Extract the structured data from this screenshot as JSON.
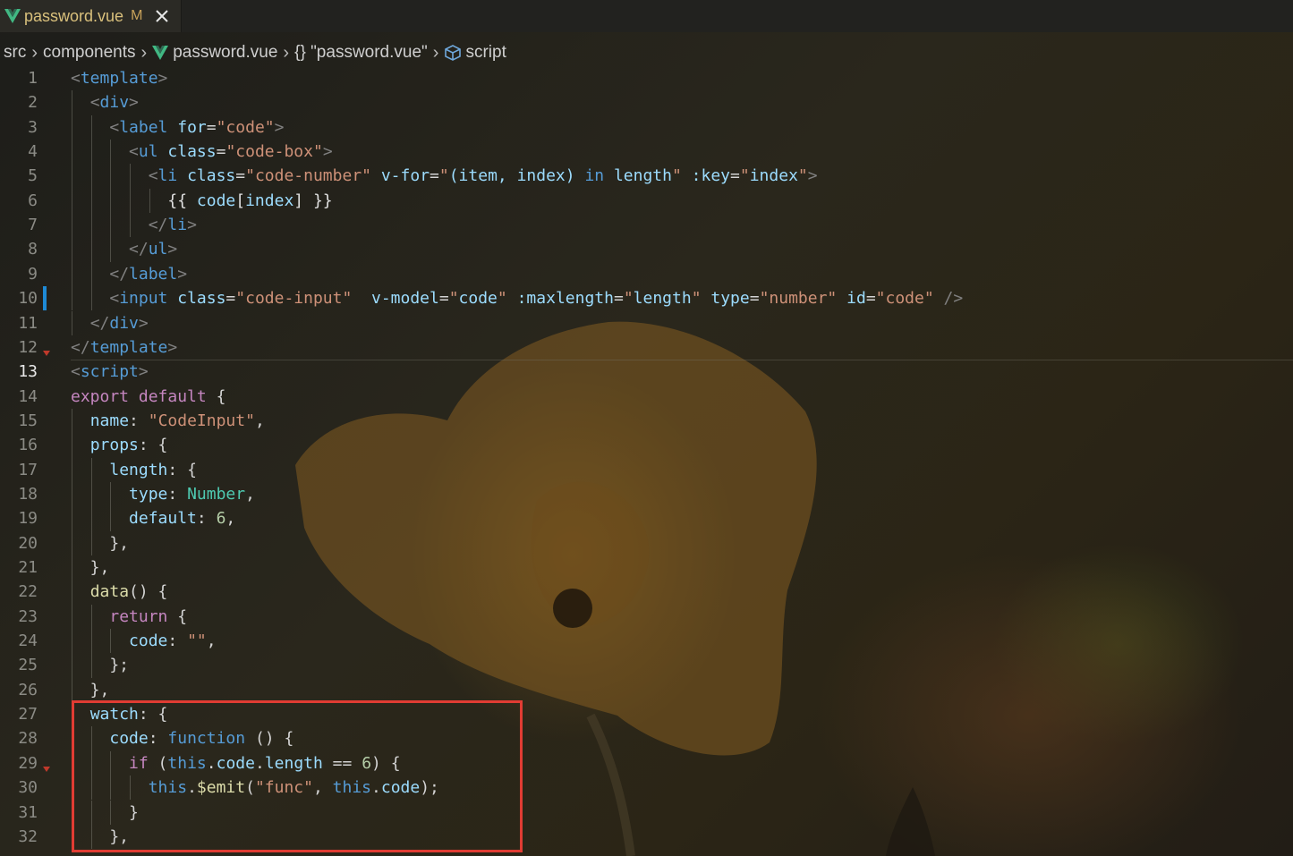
{
  "tab": {
    "label": "password.vue",
    "modified_marker": "M",
    "close_icon": "close-icon"
  },
  "breadcrumb": {
    "items": [
      "src",
      "components",
      "password.vue",
      "{} \"password.vue\"",
      "script"
    ],
    "icons": [
      "",
      "",
      "vue-file-icon",
      "",
      "cube-icon"
    ]
  },
  "colors": {
    "tag": "#569cd6",
    "attribute": "#9cdcfe",
    "string": "#ce9178",
    "keyword": "#c586c0",
    "type": "#4ec9b0",
    "number": "#b5cea8",
    "highlight_box": "#e03c33",
    "vue_icon": "#41b883"
  },
  "editor": {
    "active_line": 13,
    "lines": [
      {
        "n": "1",
        "tokens": [
          [
            "punc",
            "<"
          ],
          [
            "tag",
            "template"
          ],
          [
            "punc",
            ">"
          ]
        ]
      },
      {
        "n": "2",
        "tokens": [
          [
            "plain",
            "  "
          ],
          [
            "punc",
            "<"
          ],
          [
            "tag",
            "div"
          ],
          [
            "punc",
            ">"
          ]
        ]
      },
      {
        "n": "3",
        "tokens": [
          [
            "plain",
            "    "
          ],
          [
            "punc",
            "<"
          ],
          [
            "tag",
            "label"
          ],
          [
            "plain",
            " "
          ],
          [
            "attr",
            "for"
          ],
          [
            "plain",
            "="
          ],
          [
            "str",
            "\"code\""
          ],
          [
            "punc",
            ">"
          ]
        ]
      },
      {
        "n": "4",
        "tokens": [
          [
            "plain",
            "      "
          ],
          [
            "punc",
            "<"
          ],
          [
            "tag",
            "ul"
          ],
          [
            "plain",
            " "
          ],
          [
            "attr",
            "class"
          ],
          [
            "plain",
            "="
          ],
          [
            "str",
            "\"code-box\""
          ],
          [
            "punc",
            ">"
          ]
        ]
      },
      {
        "n": "5",
        "tokens": [
          [
            "plain",
            "        "
          ],
          [
            "punc",
            "<"
          ],
          [
            "tag",
            "li"
          ],
          [
            "plain",
            " "
          ],
          [
            "attr",
            "class"
          ],
          [
            "plain",
            "="
          ],
          [
            "str",
            "\"code-number\""
          ],
          [
            "plain",
            " "
          ],
          [
            "attr",
            "v-for"
          ],
          [
            "plain",
            "="
          ],
          [
            "str",
            "\""
          ],
          [
            "attr",
            "(item, index) "
          ],
          [
            "blue",
            "in"
          ],
          [
            "attr",
            " length"
          ],
          [
            "str",
            "\""
          ],
          [
            "plain",
            " "
          ],
          [
            "attr",
            ":key"
          ],
          [
            "plain",
            "="
          ],
          [
            "str",
            "\""
          ],
          [
            "attr",
            "index"
          ],
          [
            "str",
            "\""
          ],
          [
            "punc",
            ">"
          ]
        ]
      },
      {
        "n": "6",
        "tokens": [
          [
            "plain",
            "          "
          ],
          [
            "white",
            "{{ "
          ],
          [
            "prop",
            "code"
          ],
          [
            "white",
            "["
          ],
          [
            "prop",
            "index"
          ],
          [
            "white",
            "] }}"
          ]
        ]
      },
      {
        "n": "7",
        "tokens": [
          [
            "plain",
            "        "
          ],
          [
            "punc",
            "</"
          ],
          [
            "tag",
            "li"
          ],
          [
            "punc",
            ">"
          ]
        ]
      },
      {
        "n": "8",
        "tokens": [
          [
            "plain",
            "      "
          ],
          [
            "punc",
            "</"
          ],
          [
            "tag",
            "ul"
          ],
          [
            "punc",
            ">"
          ]
        ]
      },
      {
        "n": "9",
        "tokens": [
          [
            "plain",
            "    "
          ],
          [
            "punc",
            "</"
          ],
          [
            "tag",
            "label"
          ],
          [
            "punc",
            ">"
          ]
        ]
      },
      {
        "n": "10",
        "tokens": [
          [
            "plain",
            "    "
          ],
          [
            "punc",
            "<"
          ],
          [
            "tag",
            "input"
          ],
          [
            "plain",
            " "
          ],
          [
            "attr",
            "class"
          ],
          [
            "plain",
            "="
          ],
          [
            "str",
            "\"code-input\""
          ],
          [
            "plain",
            "  "
          ],
          [
            "attr",
            "v-model"
          ],
          [
            "plain",
            "="
          ],
          [
            "str",
            "\""
          ],
          [
            "attr",
            "code"
          ],
          [
            "str",
            "\""
          ],
          [
            "plain",
            " "
          ],
          [
            "attr",
            ":maxlength"
          ],
          [
            "plain",
            "="
          ],
          [
            "str",
            "\""
          ],
          [
            "attr",
            "length"
          ],
          [
            "str",
            "\""
          ],
          [
            "plain",
            " "
          ],
          [
            "attr",
            "type"
          ],
          [
            "plain",
            "="
          ],
          [
            "str",
            "\"number\""
          ],
          [
            "plain",
            " "
          ],
          [
            "attr",
            "id"
          ],
          [
            "plain",
            "="
          ],
          [
            "str",
            "\"code\""
          ],
          [
            "plain",
            " "
          ],
          [
            "punc",
            "/>"
          ]
        ]
      },
      {
        "n": "11",
        "tokens": [
          [
            "plain",
            "  "
          ],
          [
            "punc",
            "</"
          ],
          [
            "tag",
            "div"
          ],
          [
            "punc",
            ">"
          ]
        ]
      },
      {
        "n": "12",
        "tokens": [
          [
            "punc",
            "</"
          ],
          [
            "tag",
            "template"
          ],
          [
            "punc",
            ">"
          ]
        ]
      },
      {
        "n": "13",
        "tokens": [
          [
            "punc",
            "<"
          ],
          [
            "tag",
            "script"
          ],
          [
            "punc",
            ">"
          ]
        ]
      },
      {
        "n": "14",
        "tokens": [
          [
            "kw",
            "export"
          ],
          [
            "plain",
            " "
          ],
          [
            "kw",
            "default"
          ],
          [
            "plain",
            " {"
          ]
        ]
      },
      {
        "n": "15",
        "tokens": [
          [
            "plain",
            "  "
          ],
          [
            "prop",
            "name"
          ],
          [
            "plain",
            ": "
          ],
          [
            "str",
            "\"CodeInput\""
          ],
          [
            "plain",
            ","
          ]
        ]
      },
      {
        "n": "16",
        "tokens": [
          [
            "plain",
            "  "
          ],
          [
            "prop",
            "props"
          ],
          [
            "plain",
            ": {"
          ]
        ]
      },
      {
        "n": "17",
        "tokens": [
          [
            "plain",
            "    "
          ],
          [
            "prop",
            "length"
          ],
          [
            "plain",
            ": {"
          ]
        ]
      },
      {
        "n": "18",
        "tokens": [
          [
            "plain",
            "      "
          ],
          [
            "prop",
            "type"
          ],
          [
            "plain",
            ": "
          ],
          [
            "type",
            "Number"
          ],
          [
            "plain",
            ","
          ]
        ]
      },
      {
        "n": "19",
        "tokens": [
          [
            "plain",
            "      "
          ],
          [
            "prop",
            "default"
          ],
          [
            "plain",
            ": "
          ],
          [
            "num",
            "6"
          ],
          [
            "plain",
            ","
          ]
        ]
      },
      {
        "n": "20",
        "tokens": [
          [
            "plain",
            "    },"
          ]
        ]
      },
      {
        "n": "21",
        "tokens": [
          [
            "plain",
            "  },"
          ]
        ]
      },
      {
        "n": "22",
        "tokens": [
          [
            "plain",
            "  "
          ],
          [
            "fn",
            "data"
          ],
          [
            "plain",
            "() {"
          ]
        ]
      },
      {
        "n": "23",
        "tokens": [
          [
            "plain",
            "    "
          ],
          [
            "kw",
            "return"
          ],
          [
            "plain",
            " {"
          ]
        ]
      },
      {
        "n": "24",
        "tokens": [
          [
            "plain",
            "      "
          ],
          [
            "prop",
            "code"
          ],
          [
            "plain",
            ": "
          ],
          [
            "str",
            "\"\""
          ],
          [
            "plain",
            ","
          ]
        ]
      },
      {
        "n": "25",
        "tokens": [
          [
            "plain",
            "    };"
          ]
        ]
      },
      {
        "n": "26",
        "tokens": [
          [
            "plain",
            "  },"
          ]
        ]
      },
      {
        "n": "27",
        "tokens": [
          [
            "plain",
            "  "
          ],
          [
            "prop",
            "watch"
          ],
          [
            "plain",
            ": {"
          ]
        ]
      },
      {
        "n": "28",
        "tokens": [
          [
            "plain",
            "    "
          ],
          [
            "prop",
            "code"
          ],
          [
            "plain",
            ": "
          ],
          [
            "blue",
            "function"
          ],
          [
            "plain",
            " () {"
          ]
        ]
      },
      {
        "n": "29",
        "tokens": [
          [
            "plain",
            "      "
          ],
          [
            "kw",
            "if"
          ],
          [
            "plain",
            " ("
          ],
          [
            "blue",
            "this"
          ],
          [
            "plain",
            "."
          ],
          [
            "prop",
            "code"
          ],
          [
            "plain",
            "."
          ],
          [
            "prop",
            "length"
          ],
          [
            "plain",
            " == "
          ],
          [
            "num",
            "6"
          ],
          [
            "plain",
            ") {"
          ]
        ]
      },
      {
        "n": "30",
        "tokens": [
          [
            "plain",
            "        "
          ],
          [
            "blue",
            "this"
          ],
          [
            "plain",
            "."
          ],
          [
            "fn",
            "$emit"
          ],
          [
            "plain",
            "("
          ],
          [
            "str",
            "\"func\""
          ],
          [
            "plain",
            ", "
          ],
          [
            "blue",
            "this"
          ],
          [
            "plain",
            "."
          ],
          [
            "prop",
            "code"
          ],
          [
            "plain",
            ");"
          ]
        ]
      },
      {
        "n": "31",
        "tokens": [
          [
            "plain",
            "      }"
          ]
        ]
      },
      {
        "n": "32",
        "tokens": [
          [
            "plain",
            "    },"
          ]
        ]
      }
    ]
  }
}
